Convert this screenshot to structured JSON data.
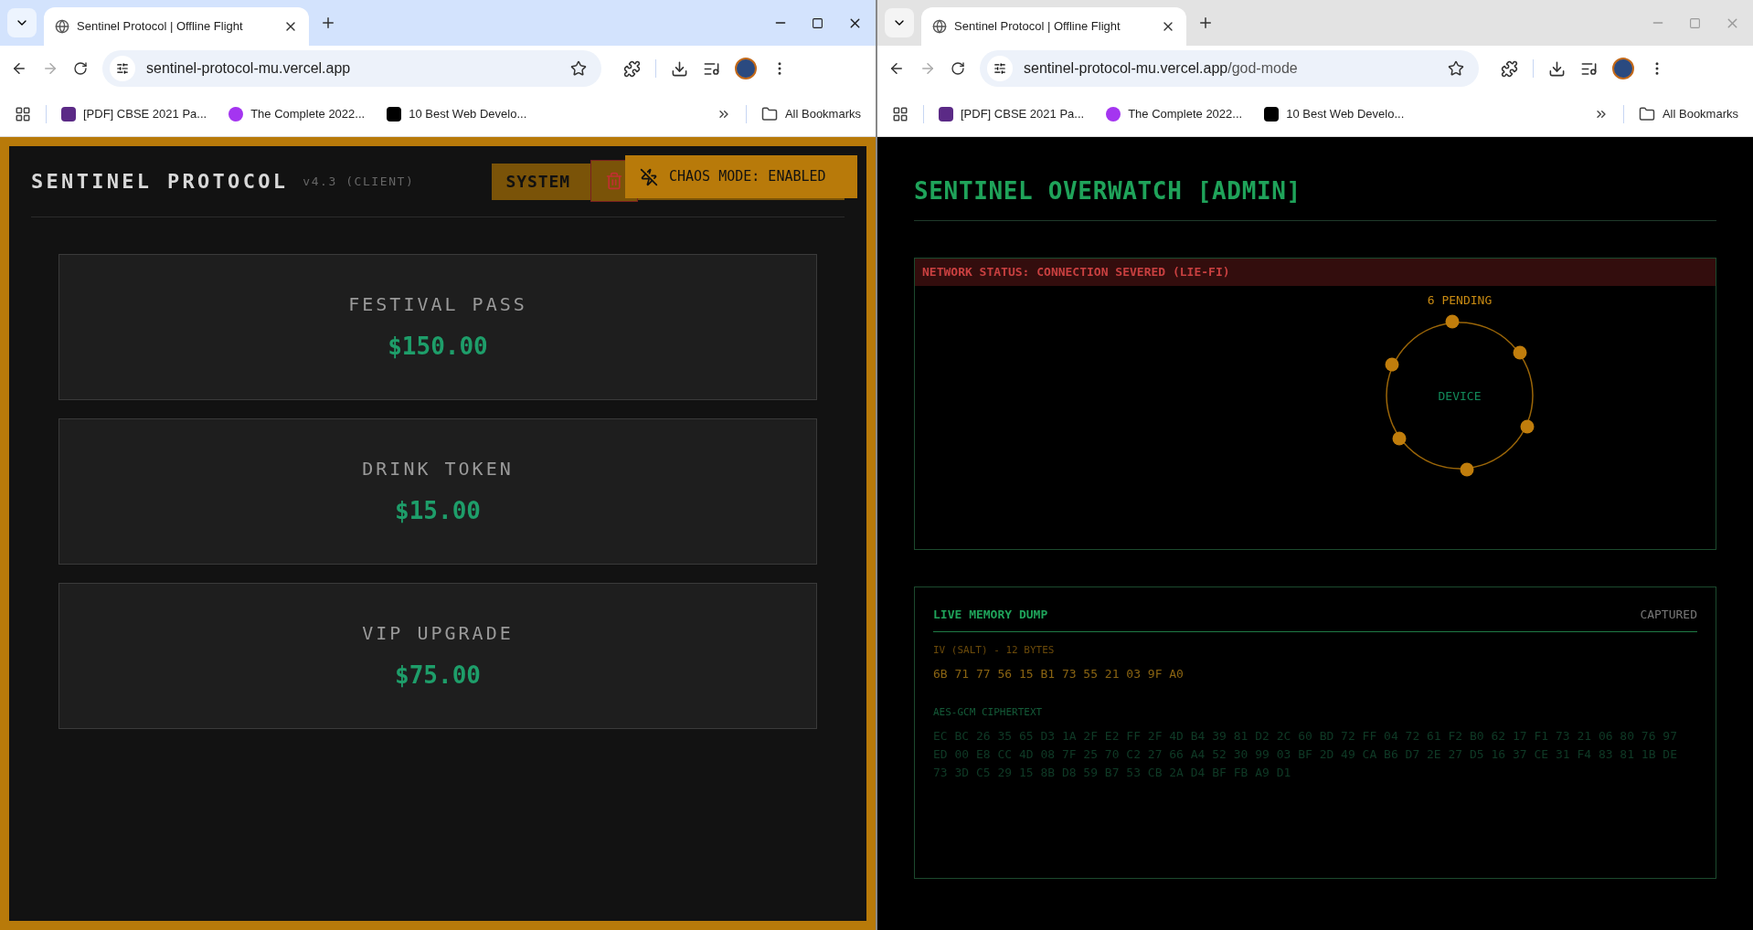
{
  "windows": [
    {
      "focused": true,
      "tab": {
        "title": "Sentinel Protocol | Offline Flight"
      },
      "url": {
        "host": "sentinel-protocol-mu.vercel.app"
      },
      "bookmarks": [
        "[PDF] CBSE 2021 Pa...",
        "The Complete 2022...",
        "10 Best Web Develo..."
      ],
      "all_bookmarks": "All Bookmarks",
      "page": {
        "kind": "client",
        "title": "SENTINEL PROTOCOL",
        "version": "v4.3 (CLIENT)",
        "system_button": "SYSTEM",
        "toast": "CHAOS MODE: ENABLED",
        "products": [
          {
            "name": "FESTIVAL PASS",
            "price": "$150.00"
          },
          {
            "name": "DRINK TOKEN",
            "price": "$15.00"
          },
          {
            "name": "VIP UPGRADE",
            "price": "$75.00"
          }
        ]
      }
    },
    {
      "focused": false,
      "tab": {
        "title": "Sentinel Protocol | Offline Flight"
      },
      "url": {
        "host": "sentinel-protocol-mu.vercel.app",
        "path": "/god-mode"
      },
      "bookmarks": [
        "[PDF] CBSE 2021 Pa...",
        "The Complete 2022...",
        "10 Best Web Develo..."
      ],
      "all_bookmarks": "All Bookmarks",
      "page": {
        "kind": "admin",
        "title": "SENTINEL OVERWATCH [ADMIN]",
        "network": {
          "status": "NETWORK STATUS: CONNECTION SEVERED (LIE-FI)",
          "pending": "6 PENDING",
          "device": "DEVICE"
        },
        "memory": {
          "title": "LIVE MEMORY DUMP",
          "state": "CAPTURED",
          "iv_label": "IV (SALT) - 12 BYTES",
          "iv": "6B 71 77 56 15 B1 73 55 21 03 9F A0",
          "cipher_label": "AES-GCM CIPHERTEXT",
          "cipher": "EC BC 26 35 65 D3 1A 2F E2 FF 2F 4D B4 39 81 D2 2C 60 BD 72 FF 04 72 61 F2 B0 62 17 F1 73 21 06 80 76 97 ED 00 E8 CC 4D 08 7F 25 70 C2 27 66 A4 52 30 99 03 BF 2D 49 CA B6 D7 2E 27 D5 16 37 CE 31 F4 83 81 1B DE 73 3D C5 29 15 8B D8 59 B7 53 CB 2A D4 BF FB A9 D1"
        }
      }
    }
  ]
}
